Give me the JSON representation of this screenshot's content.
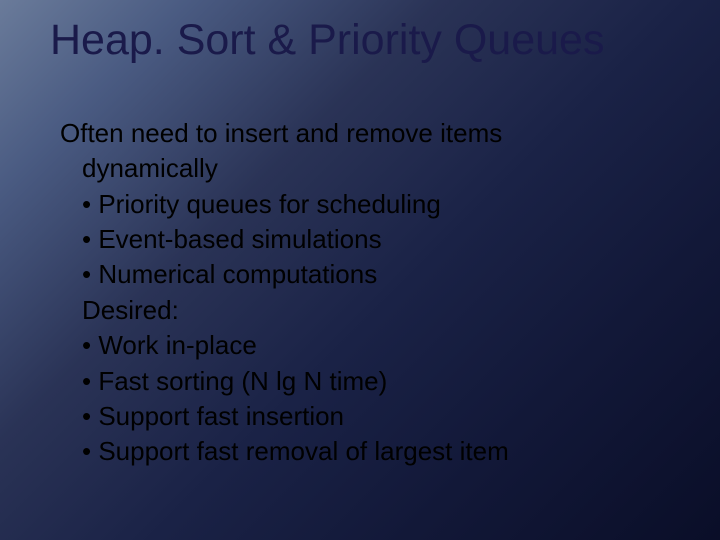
{
  "title": "Heap. Sort & Priority Queues",
  "intro_line1": "Often need to insert and remove items",
  "intro_line2": "dynamically",
  "bullets_a": [
    "• Priority queues for scheduling",
    "• Event-based simulations",
    "• Numerical computations"
  ],
  "desired_label": "Desired:",
  "bullets_b": [
    "• Work in-place",
    "• Fast sorting (N lg N time)",
    "• Support fast insertion",
    "• Support fast removal of largest item"
  ]
}
